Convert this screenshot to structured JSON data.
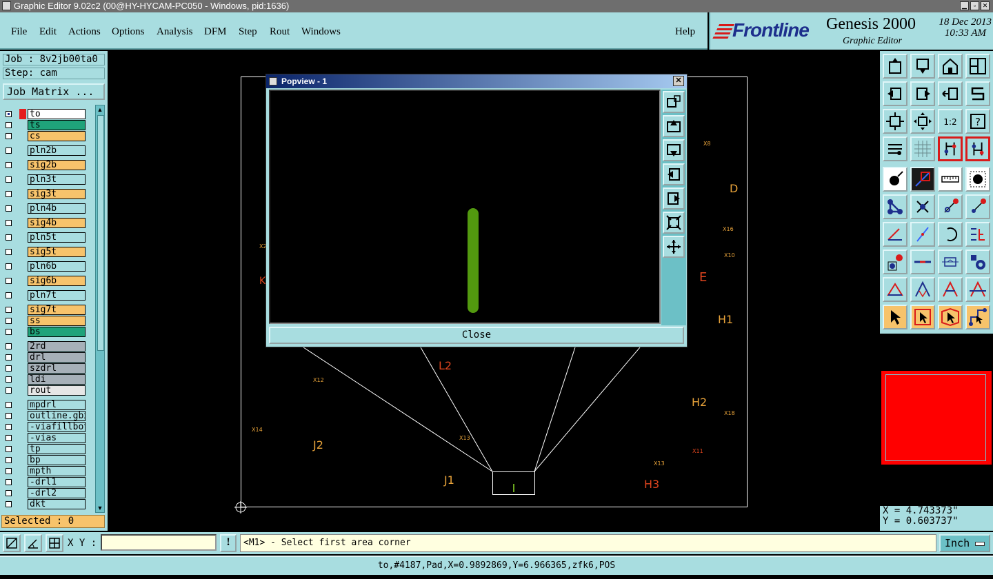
{
  "window": {
    "title": "Graphic Editor 9.02c2 (00@HY-HYCAM-PC050 - Windows, pid:1636)"
  },
  "menu": {
    "items": [
      "File",
      "Edit",
      "Actions",
      "Options",
      "Analysis",
      "DFM",
      "Step",
      "Rout",
      "Windows"
    ],
    "help": "Help"
  },
  "brand": {
    "logo": "Frontline",
    "product": "Genesis 2000",
    "subtitle": "Graphic Editor",
    "date": "18 Dec 2013",
    "time": "10:33 AM"
  },
  "job": {
    "job_label": "Job : 8v2jb00ta0",
    "step_label": "Step: cam",
    "matrix_button": "Job Matrix ..."
  },
  "layers": [
    {
      "name": "to",
      "color": "#ffffff",
      "marker": "#e41e1e",
      "selected": true
    },
    {
      "name": "ts",
      "color": "#1fa37a"
    },
    {
      "name": "cs",
      "color": "#f7c36b"
    },
    {
      "name": "pln2b",
      "color": "#a8dde0"
    },
    {
      "name": "sig2b",
      "color": "#f7c36b"
    },
    {
      "name": "pln3t",
      "color": "#a8dde0"
    },
    {
      "name": "sig3t",
      "color": "#f7c36b"
    },
    {
      "name": "pln4b",
      "color": "#a8dde0"
    },
    {
      "name": "sig4b",
      "color": "#f7c36b"
    },
    {
      "name": "pln5t",
      "color": "#a8dde0"
    },
    {
      "name": "sig5t",
      "color": "#f7c36b"
    },
    {
      "name": "pln6b",
      "color": "#a8dde0"
    },
    {
      "name": "sig6b",
      "color": "#f7c36b"
    },
    {
      "name": "pln7t",
      "color": "#a8dde0"
    },
    {
      "name": "sig7t",
      "color": "#f7c36b"
    },
    {
      "name": "ss",
      "color": "#f7c36b"
    },
    {
      "name": "bs",
      "color": "#1fa37a"
    },
    {
      "name": "2rd",
      "color": "#a6b0b8"
    },
    {
      "name": "drl",
      "color": "#a6b0b8"
    },
    {
      "name": "szdrl",
      "color": "#a6b0b8"
    },
    {
      "name": "ldi",
      "color": "#a6b0b8"
    },
    {
      "name": "rout",
      "color": "#e6e6e6"
    },
    {
      "name": "mpdrl",
      "color": "#a8dde0"
    },
    {
      "name": "outline.gbx",
      "color": "#a8dde0"
    },
    {
      "name": "-viafillbot",
      "color": "#a8dde0"
    },
    {
      "name": "-vias",
      "color": "#a8dde0"
    },
    {
      "name": "tp",
      "color": "#a8dde0"
    },
    {
      "name": "bp",
      "color": "#a8dde0"
    },
    {
      "name": "mpth",
      "color": "#a8dde0"
    },
    {
      "name": "-drl1",
      "color": "#a8dde0"
    },
    {
      "name": "-drl2",
      "color": "#a8dde0"
    },
    {
      "name": "dkt",
      "color": "#a8dde0"
    }
  ],
  "selected": "Selected : 0",
  "canvas_labels": [
    {
      "text": "D",
      "color": "#e8a33a"
    },
    {
      "text": "E",
      "color": "#e0451e"
    },
    {
      "text": "H1",
      "color": "#e8a33a"
    },
    {
      "text": "H2",
      "color": "#e8a33a"
    },
    {
      "text": "H3",
      "color": "#e0451e"
    },
    {
      "text": "J1",
      "color": "#e8a33a"
    },
    {
      "text": "J2",
      "color": "#e8a33a"
    },
    {
      "text": "L2",
      "color": "#e0451e"
    },
    {
      "text": "X8",
      "color": "#e8a33a"
    },
    {
      "text": "X16",
      "color": "#e8a33a"
    },
    {
      "text": "X10",
      "color": "#e8a33a"
    },
    {
      "text": "X18",
      "color": "#e8a33a"
    },
    {
      "text": "X11",
      "color": "#e0451e"
    },
    {
      "text": "X12",
      "color": "#e8a33a"
    },
    {
      "text": "X13",
      "color": "#e8a33a"
    },
    {
      "text": "X14",
      "color": "#e8a33a"
    },
    {
      "text": "X2",
      "color": "#e8a33a"
    },
    {
      "text": "K",
      "color": "#e0451e"
    }
  ],
  "popview": {
    "title": "Popview - 1",
    "close_button": "Close"
  },
  "coords": {
    "x": "X = 4.743373\"",
    "y": "Y = 0.603737\""
  },
  "bottom": {
    "xy_label": "X Y :",
    "xy_value": "",
    "prompt": "<M1> - Select first area corner",
    "units": "Inch"
  },
  "status": "to,#4187,Pad,X=0.9892869,Y=6.966365,zfk6,POS"
}
